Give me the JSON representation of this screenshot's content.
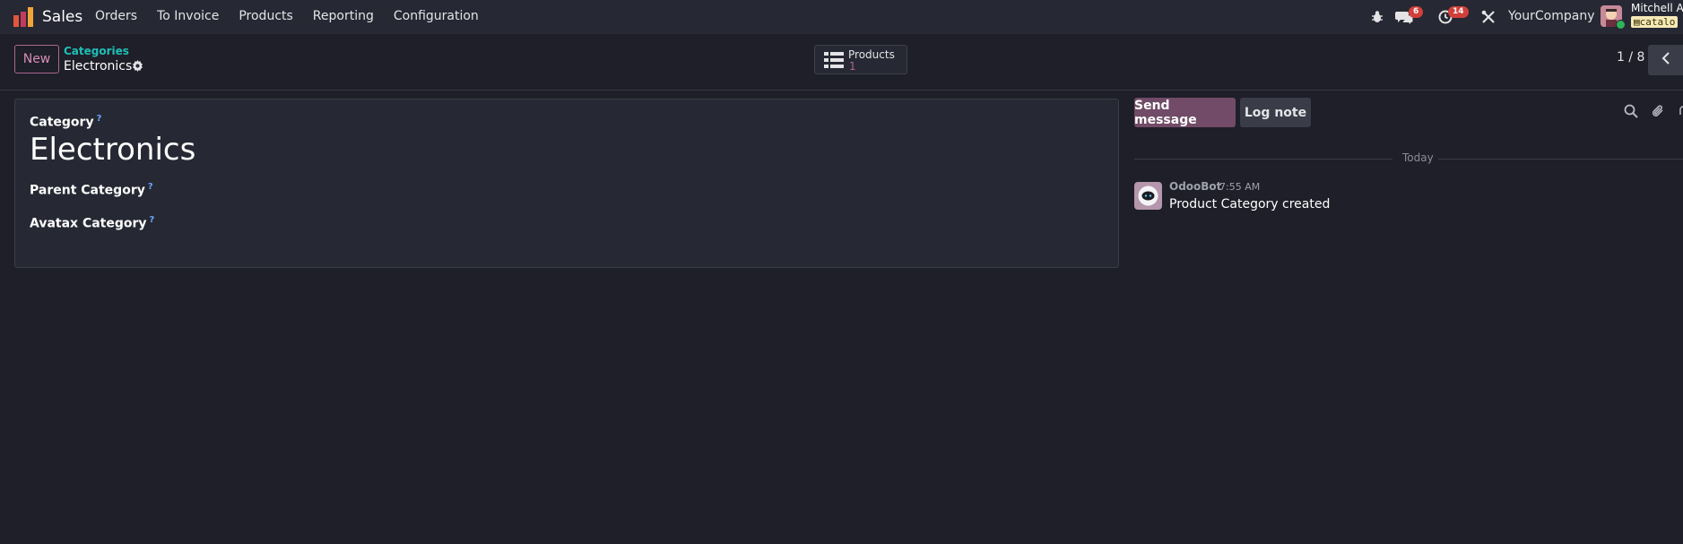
{
  "navbar": {
    "app_name": "Sales",
    "menu": [
      "Orders",
      "To Invoice",
      "Products",
      "Reporting",
      "Configuration"
    ],
    "messages_badge": "6",
    "activities_badge": "14",
    "company": "YourCompany",
    "user_name": "Mitchell Ad",
    "database": "catalo",
    "icons": [
      "bug-icon",
      "chat-icon",
      "clock-icon",
      "tools-icon"
    ]
  },
  "control": {
    "new_label": "New",
    "breadcrumb_parent": "Categories",
    "breadcrumb_current": "Electronics",
    "smart_button_label": "Products",
    "smart_button_count": "1",
    "pager": "1 / 8"
  },
  "form": {
    "category_label": "Category",
    "category_value": "Electronics",
    "parent_label": "Parent Category",
    "avatax_label": "Avatax Category",
    "help_mark": "?"
  },
  "chatter": {
    "send_label": "Send message",
    "log_label": "Log note",
    "date_separator": "Today",
    "message": {
      "author": "OdooBot",
      "time": "7:55 AM",
      "body": "Product Category created"
    }
  },
  "colors": {
    "background": "#1e1f28",
    "panel": "#262833",
    "primary": "#714b67",
    "link": "#1fbfb8",
    "badge": "#d23f3a"
  }
}
